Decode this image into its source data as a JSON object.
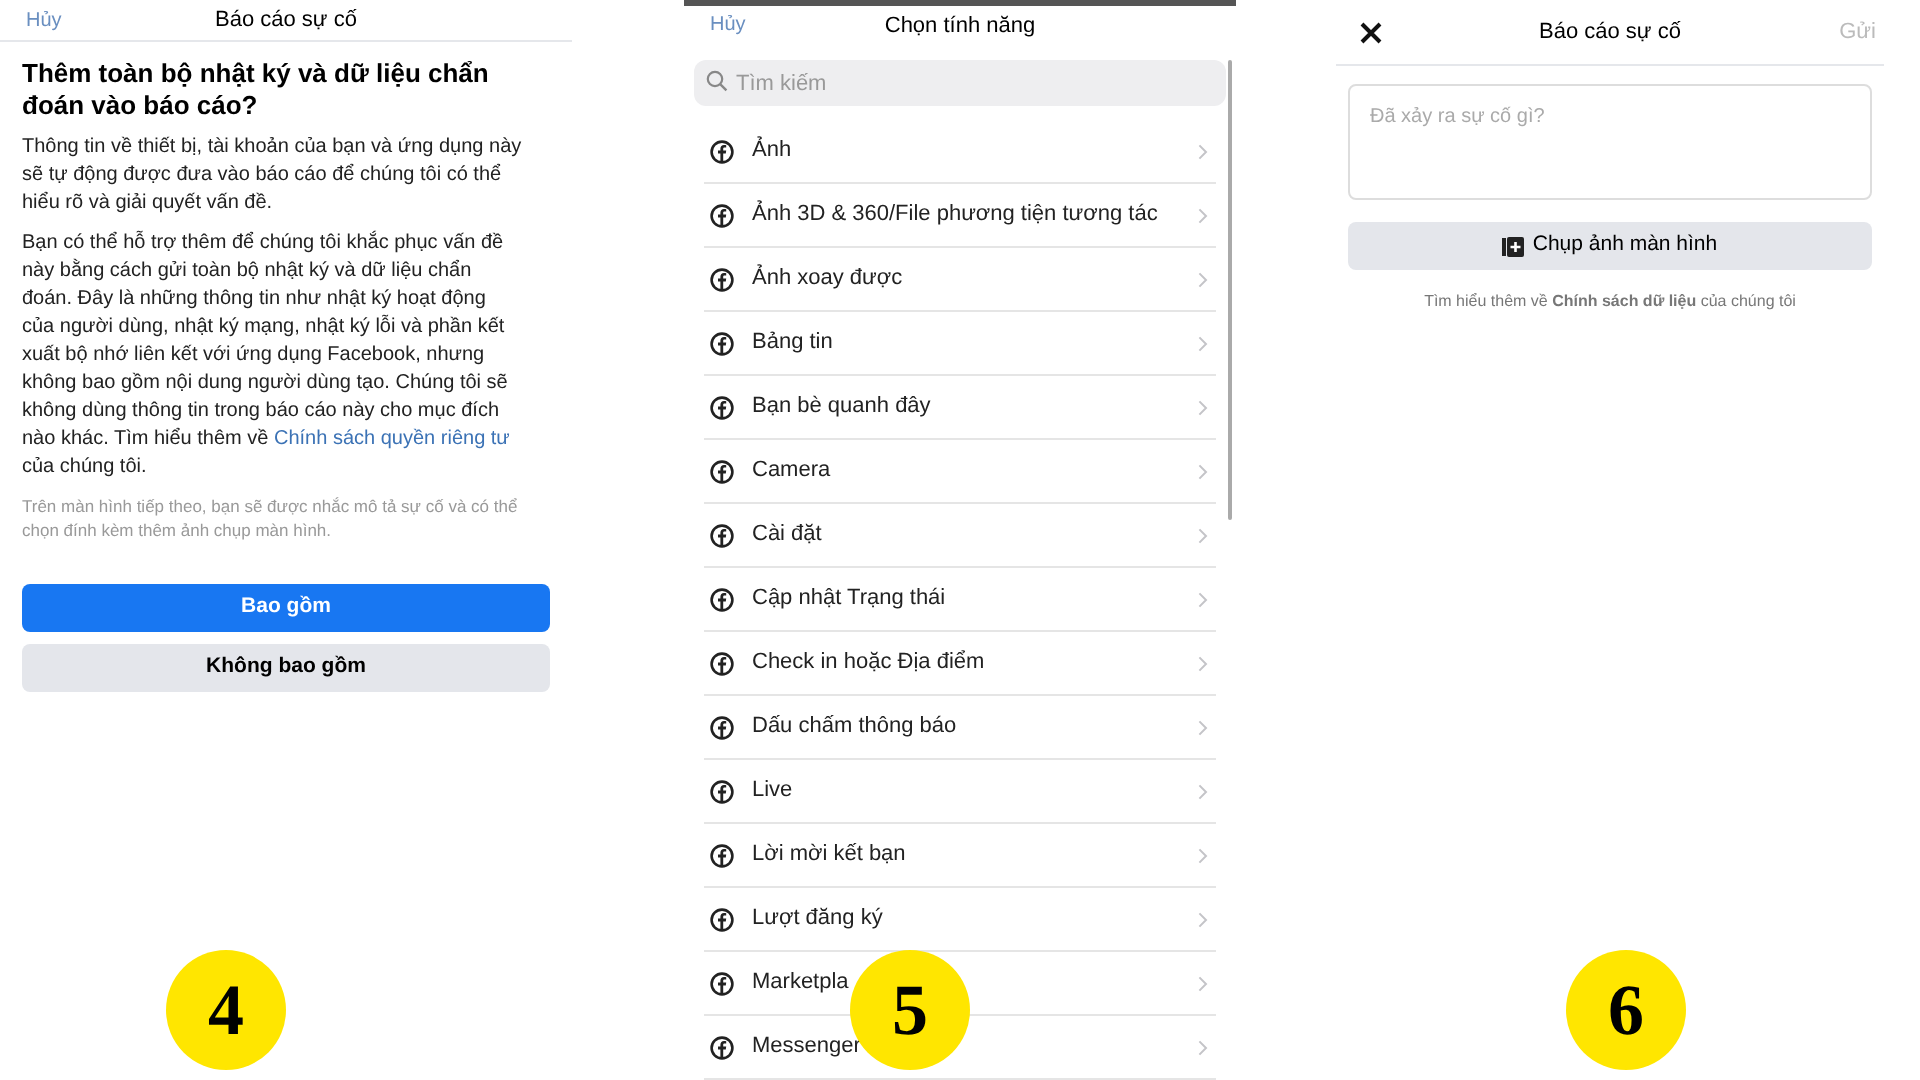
{
  "screens": [
    {
      "kind": "consent",
      "cancel": "Hủy",
      "title": "Báo cáo sự cố",
      "heading": "Thêm toàn bộ nhật ký và dữ liệu chẩn đoán vào báo cáo?",
      "paragraph_1": "Thông tin về thiết bị, tài khoản của bạn và ứng dụng này sẽ tự động được đưa vào báo cáo để chúng tôi có thể hiểu rõ và giải quyết vấn đề.",
      "paragraph_2": "Bạn có thể hỗ trợ thêm để chúng tôi khắc phục vấn đề này bằng cách gửi toàn bộ nhật ký và dữ liệu chẩn đoán. Đây là những thông tin như nhật ký hoạt động của người dùng, nhật ký mạng, nhật ký lỗi và phần kết xuất bộ nhớ liên kết với ứng dụng Facebook, nhưng không bao gồm nội dung người dùng tạo. Chúng tôi sẽ không dùng thông tin trong báo cáo này cho mục đích nào khác. Tìm hiểu thêm về",
      "paragraph_2_link": "Chính sách quyền riêng tư",
      "paragraph_2_end": "của chúng tôi.",
      "note": "Trên màn hình tiếp theo, bạn sẽ được nhắc mô tả sự cố và có thể chọn đính kèm thêm ảnh chụp màn hình.",
      "primary_button": "Bao gồm",
      "secondary_button": "Không bao gồm",
      "badge": "4"
    },
    {
      "kind": "features",
      "cancel": "Hủy",
      "title": "Chọn tính năng",
      "search": {
        "placeholder": "Tìm kiếm"
      },
      "items": [
        "Ảnh",
        "Ảnh 3D & 360/File phương tiện tương tác",
        "Ảnh xoay được",
        "Bảng tin",
        "Bạn bè quanh đây",
        "Camera",
        "Cài đặt",
        "Cập nhật Trạng thái",
        "Check in hoặc Địa điểm",
        "Dấu chấm thông báo",
        "Live",
        "Lời mời kết bạn",
        "Lượt đăng ký",
        "Marketpla",
        "Messenger"
      ],
      "badge": "5"
    },
    {
      "kind": "report",
      "title": "Báo cáo sự cố",
      "send": "Gửi",
      "input": {
        "placeholder": "Đã xảy ra sự cố gì?"
      },
      "screenshot_button": "Chụp ảnh màn hình",
      "footer": "Tìm hiểu thêm về **Chính sách dữ liệu** của chúng tôi",
      "badge": "6"
    }
  ]
}
